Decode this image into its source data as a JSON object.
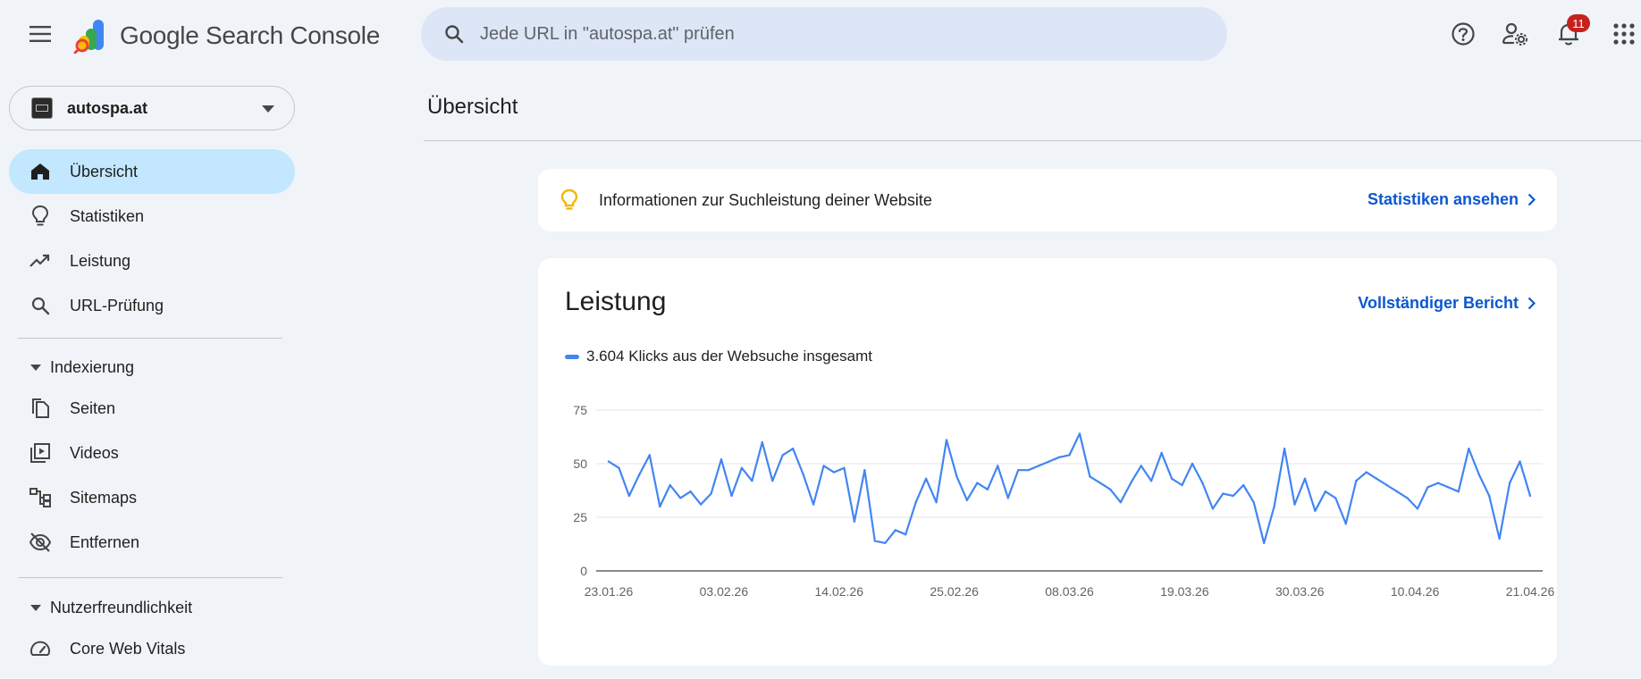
{
  "app": {
    "title": "Google Search Console"
  },
  "search": {
    "placeholder": "Jede URL in \"autospa.at\" prüfen"
  },
  "header_icons": {
    "help": "help-icon",
    "account_settings": "manage-accounts-icon",
    "notifications": "notifications-icon",
    "notifications_count": "11",
    "apps": "apps-grid-icon"
  },
  "sidebar": {
    "property": "autospa.at",
    "items": [
      {
        "label": "Übersicht",
        "icon": "home-icon",
        "active": true
      },
      {
        "label": "Statistiken",
        "icon": "lightbulb-icon"
      },
      {
        "label": "Leistung",
        "icon": "trending-up-icon"
      },
      {
        "label": "URL-Prüfung",
        "icon": "search-icon"
      }
    ],
    "sections": [
      {
        "label": "Indexierung",
        "items": [
          {
            "label": "Seiten",
            "icon": "pages-icon"
          },
          {
            "label": "Videos",
            "icon": "video-library-icon"
          },
          {
            "label": "Sitemaps",
            "icon": "sitemap-icon"
          },
          {
            "label": "Entfernen",
            "icon": "visibility-off-icon"
          }
        ]
      },
      {
        "label": "Nutzerfreundlichkeit",
        "items": [
          {
            "label": "Core Web Vitals",
            "icon": "speed-gauge-icon"
          }
        ]
      }
    ]
  },
  "main": {
    "title": "Übersicht",
    "insight": {
      "text": "Informationen zur Suchleistung deiner Website",
      "link": "Statistiken ansehen"
    },
    "performance": {
      "title": "Leistung",
      "link": "Vollständiger Bericht",
      "legend": "3.604 Klicks aus der Websuche insgesamt"
    }
  },
  "colors": {
    "accent": "#0b57d0",
    "line": "#4285f4",
    "active_nav": "#c2e7ff",
    "background": "#f0f4f9"
  },
  "chart_data": {
    "type": "line",
    "ylim": [
      0,
      75
    ],
    "yticks": [
      "0",
      "25",
      "50",
      "75"
    ],
    "xticks": [
      "23.01.26",
      "03.02.26",
      "14.02.26",
      "25.02.26",
      "08.03.26",
      "19.03.26",
      "30.03.26",
      "10.04.26",
      "21.04.26"
    ],
    "grid": true,
    "series": [
      {
        "name": "3.604 Klicks aus der Websuche insgesamt",
        "color": "#4285f4",
        "values": [
          51,
          48,
          35,
          45,
          54,
          30,
          40,
          34,
          37,
          31,
          36,
          52,
          35,
          48,
          42,
          60,
          42,
          54,
          57,
          45,
          31,
          49,
          46,
          48,
          23,
          47,
          14,
          13,
          19,
          17,
          32,
          43,
          32,
          61,
          44,
          33,
          41,
          38,
          49,
          34,
          47,
          47,
          49,
          51,
          53,
          54,
          64,
          44,
          41,
          38,
          32,
          41,
          49,
          42,
          55,
          43,
          40,
          50,
          41,
          29,
          36,
          35,
          40,
          32,
          13,
          30,
          57,
          31,
          43,
          28,
          37,
          34,
          22,
          42,
          46,
          43,
          40,
          37,
          34,
          29,
          39,
          41,
          39,
          37,
          57,
          45,
          35,
          15,
          41,
          51,
          35
        ]
      }
    ]
  }
}
